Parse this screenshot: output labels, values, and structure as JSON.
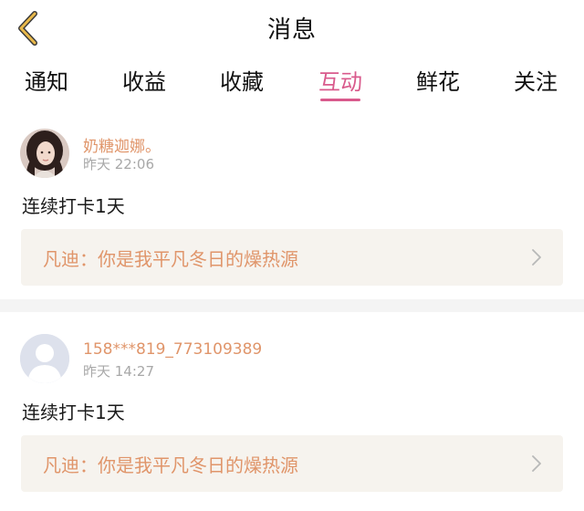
{
  "header": {
    "title": "消息"
  },
  "tabs": [
    {
      "label": "通知"
    },
    {
      "label": "收益"
    },
    {
      "label": "收藏"
    },
    {
      "label": "互动",
      "active": true
    },
    {
      "label": "鲜花"
    },
    {
      "label": "关注"
    }
  ],
  "messages": [
    {
      "username": "奶糖迦娜。",
      "time": "昨天 22:06",
      "content": "连续打卡1天",
      "quote": "凡迪：你是我平凡冬日的燥热源",
      "avatar": "photo-avatar"
    },
    {
      "username": "158***819_773109389",
      "time": "昨天 14:27",
      "content": "连续打卡1天",
      "quote": "凡迪：你是我平凡冬日的燥热源",
      "avatar": "default-avatar"
    }
  ],
  "colors": {
    "accent": "#d95a8c",
    "username": "#e0956a",
    "back_arrow": "#e8b84a",
    "quote_bg": "#f6f3ee"
  }
}
